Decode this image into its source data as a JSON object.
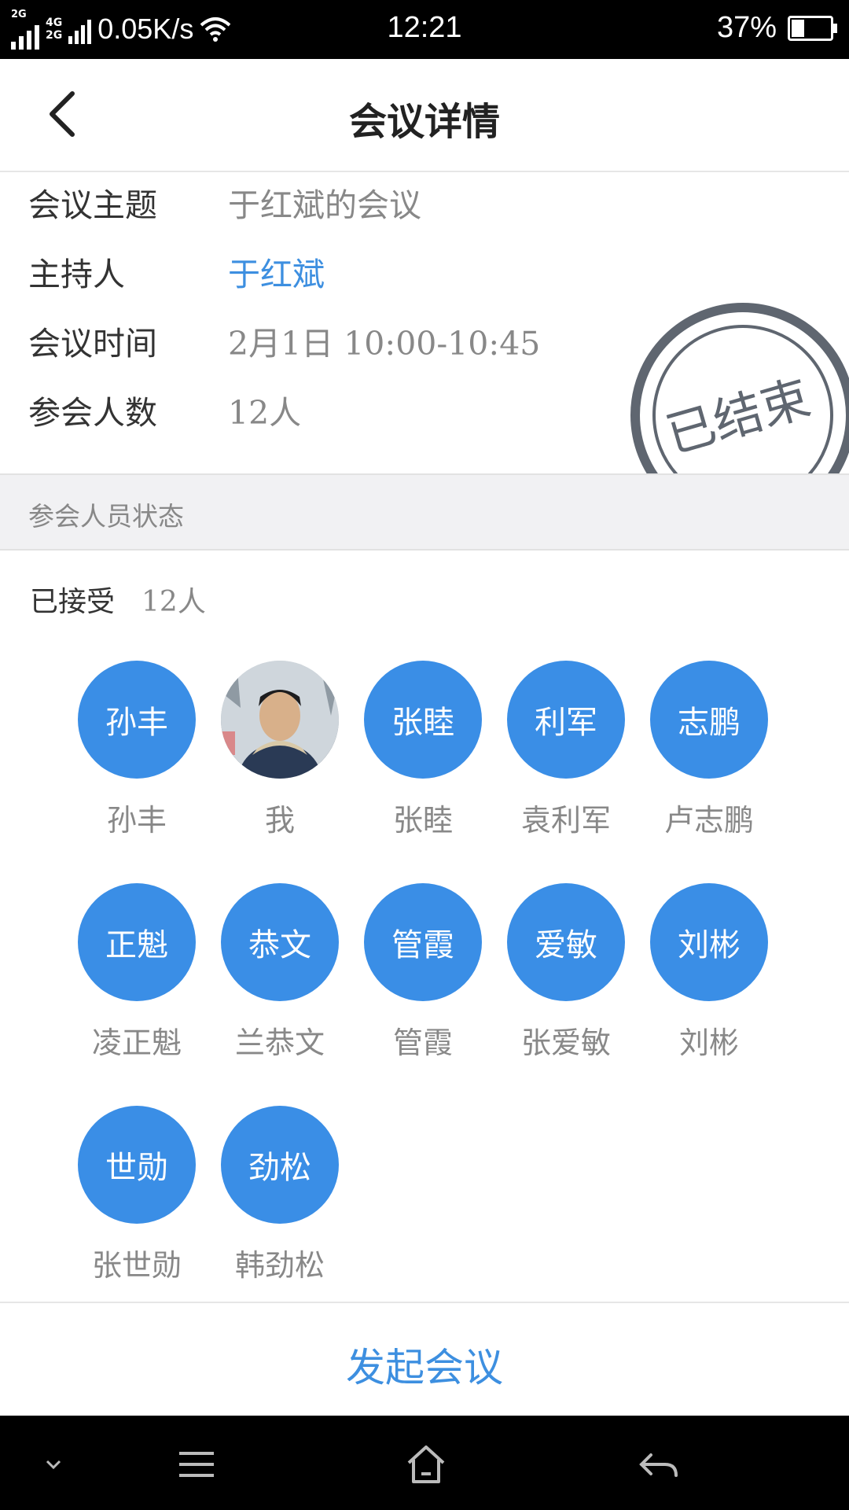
{
  "status_bar": {
    "network_top": "4G",
    "network_bottom": "2G",
    "signal_label": "2G",
    "speed": "0.05K/s",
    "time": "12:21",
    "battery": "37%",
    "battery_level": 0.37
  },
  "header": {
    "title": "会议详情"
  },
  "meeting": {
    "topic_label": "会议主题",
    "topic": "于红斌的会议",
    "host_label": "主持人",
    "host": "于红斌",
    "time_label": "会议时间",
    "time": "2月1日 10:00-10:45",
    "count_label": "参会人数",
    "count": "12人",
    "stamp": "已结束"
  },
  "section_title": "参会人员状态",
  "accepted": {
    "label": "已接受",
    "count": "12人"
  },
  "participants": [
    {
      "avatar": "孙丰",
      "name": "孙丰"
    },
    {
      "avatar": "",
      "name": "我",
      "photo": true
    },
    {
      "avatar": "张睦",
      "name": "张睦"
    },
    {
      "avatar": "利军",
      "name": "袁利军"
    },
    {
      "avatar": "志鹏",
      "name": "卢志鹏"
    },
    {
      "avatar": "正魁",
      "name": "凌正魁"
    },
    {
      "avatar": "恭文",
      "name": "兰恭文"
    },
    {
      "avatar": "管霞",
      "name": "管霞"
    },
    {
      "avatar": "爱敏",
      "name": "张爱敏"
    },
    {
      "avatar": "刘彬",
      "name": "刘彬"
    },
    {
      "avatar": "世勋",
      "name": "张世勋"
    },
    {
      "avatar": "劲松",
      "name": "韩劲松"
    }
  ],
  "footer": {
    "action": "发起会议"
  },
  "colors": {
    "accent": "#3d8fe0",
    "avatar": "#3a8ee6",
    "stamp": "#5f6670"
  }
}
